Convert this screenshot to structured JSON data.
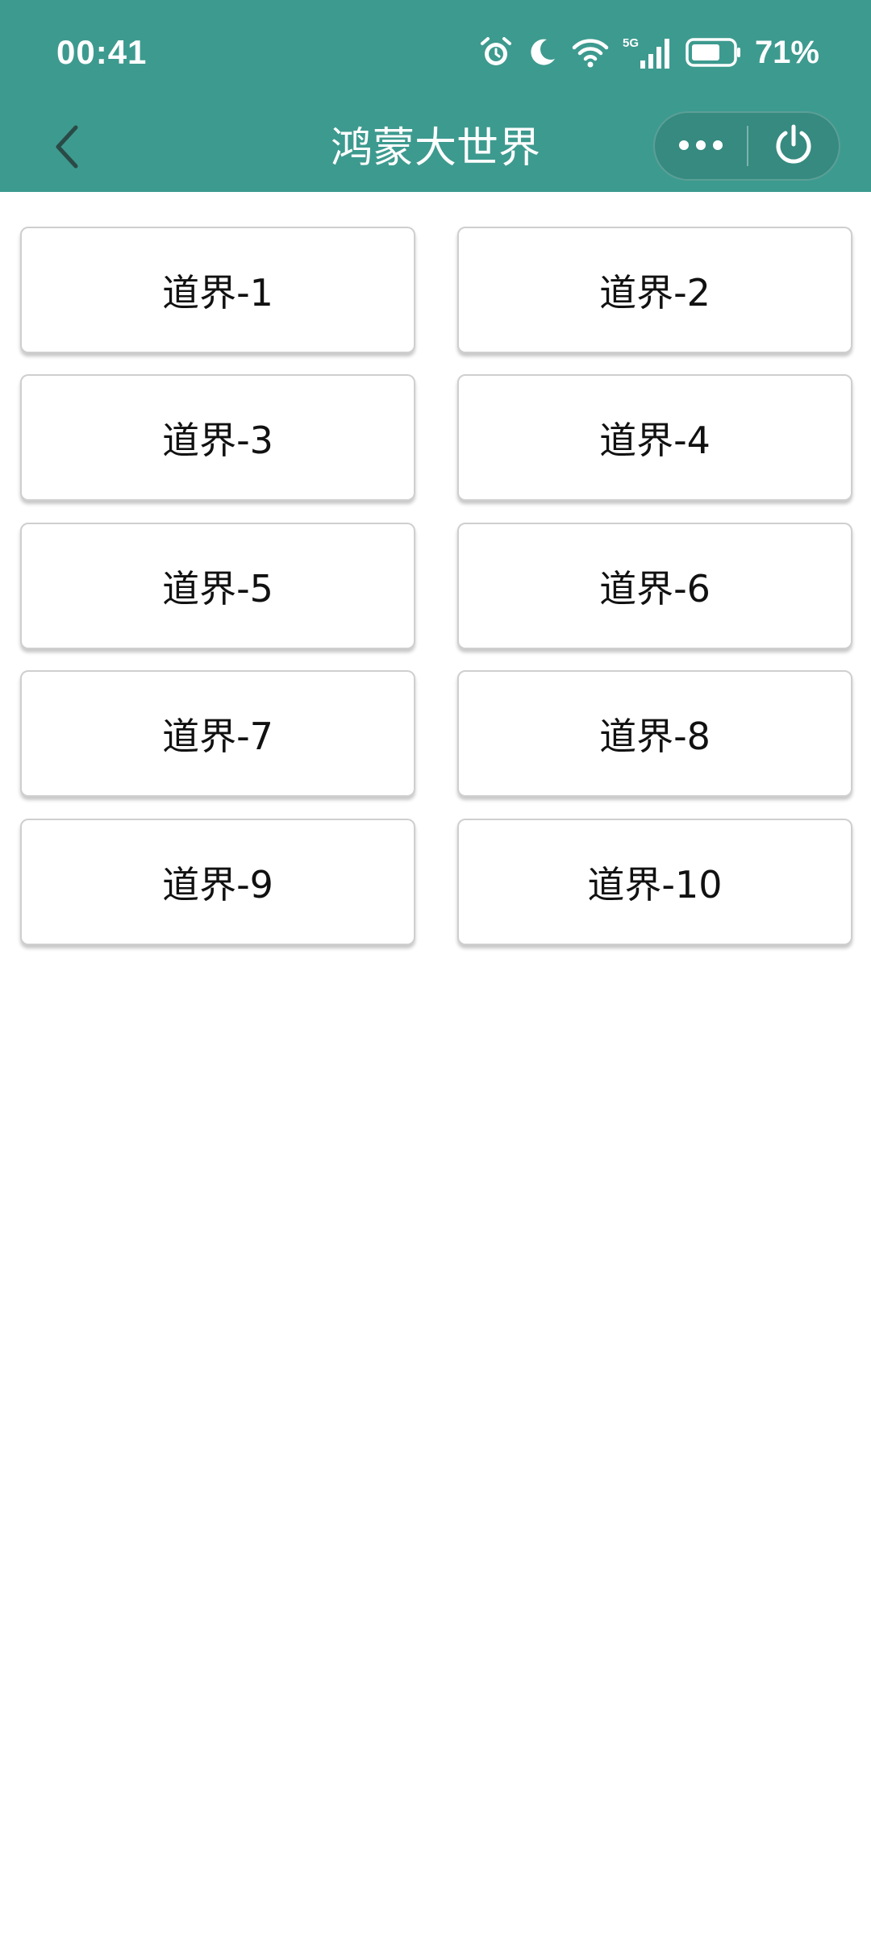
{
  "status_bar": {
    "time": "00:41",
    "network": "5G",
    "battery_percent": "71%",
    "battery_level": 0.71,
    "icons": [
      "alarm-icon",
      "moon-icon",
      "wifi-icon",
      "signal-5g-icon",
      "battery-icon"
    ]
  },
  "nav": {
    "title": "鸿蒙大世界",
    "back_icon": "chevron-left-icon",
    "more_icon": "more-dots-icon",
    "close_icon": "power-icon"
  },
  "realms": [
    {
      "label": "道界-1"
    },
    {
      "label": "道界-2"
    },
    {
      "label": "道界-3"
    },
    {
      "label": "道界-4"
    },
    {
      "label": "道界-5"
    },
    {
      "label": "道界-6"
    },
    {
      "label": "道界-7"
    },
    {
      "label": "道界-8"
    },
    {
      "label": "道界-9"
    },
    {
      "label": "道界-10"
    }
  ],
  "colors": {
    "header_bg": "#3d9a8f",
    "page_bg": "#ffffff",
    "button_border": "#cfcfcf",
    "button_text": "#111111"
  }
}
